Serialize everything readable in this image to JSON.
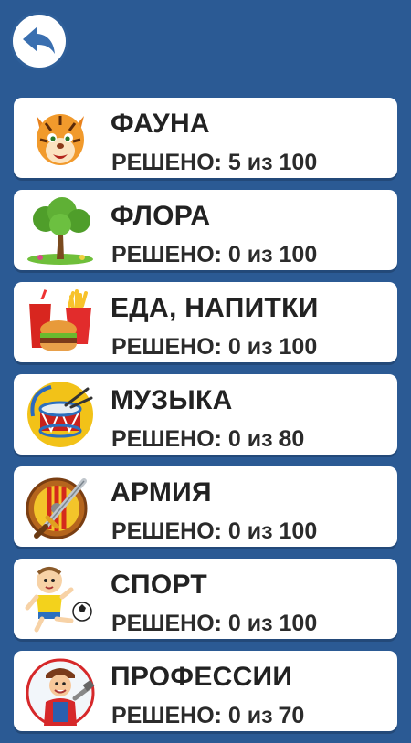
{
  "header": {
    "back_icon": "undo-arrow-icon"
  },
  "categories": [
    {
      "title": "ФАУНА",
      "solved": "РЕШЕНО: 5 из 100",
      "icon": "tiger-icon"
    },
    {
      "title": "ФЛОРА",
      "solved": "РЕШЕНО: 0 из 100",
      "icon": "tree-icon"
    },
    {
      "title": "ЕДА, НАПИТКИ",
      "solved": "РЕШЕНО: 0 из 100",
      "icon": "fast-food-icon"
    },
    {
      "title": "МУЗЫКА",
      "solved": "РЕШЕНО: 0 из 80",
      "icon": "drum-icon"
    },
    {
      "title": "АРМИЯ",
      "solved": "РЕШЕНО: 0 из 100",
      "icon": "shield-sword-icon"
    },
    {
      "title": "СПОРТ",
      "solved": "РЕШЕНО: 0 из 100",
      "icon": "soccer-kid-icon"
    },
    {
      "title": "ПРОФЕССИИ",
      "solved": "РЕШЕНО: 0 из 70",
      "icon": "worker-icon"
    }
  ],
  "colors": {
    "background": "#2b5a94",
    "card": "#ffffff",
    "text": "#222222"
  }
}
